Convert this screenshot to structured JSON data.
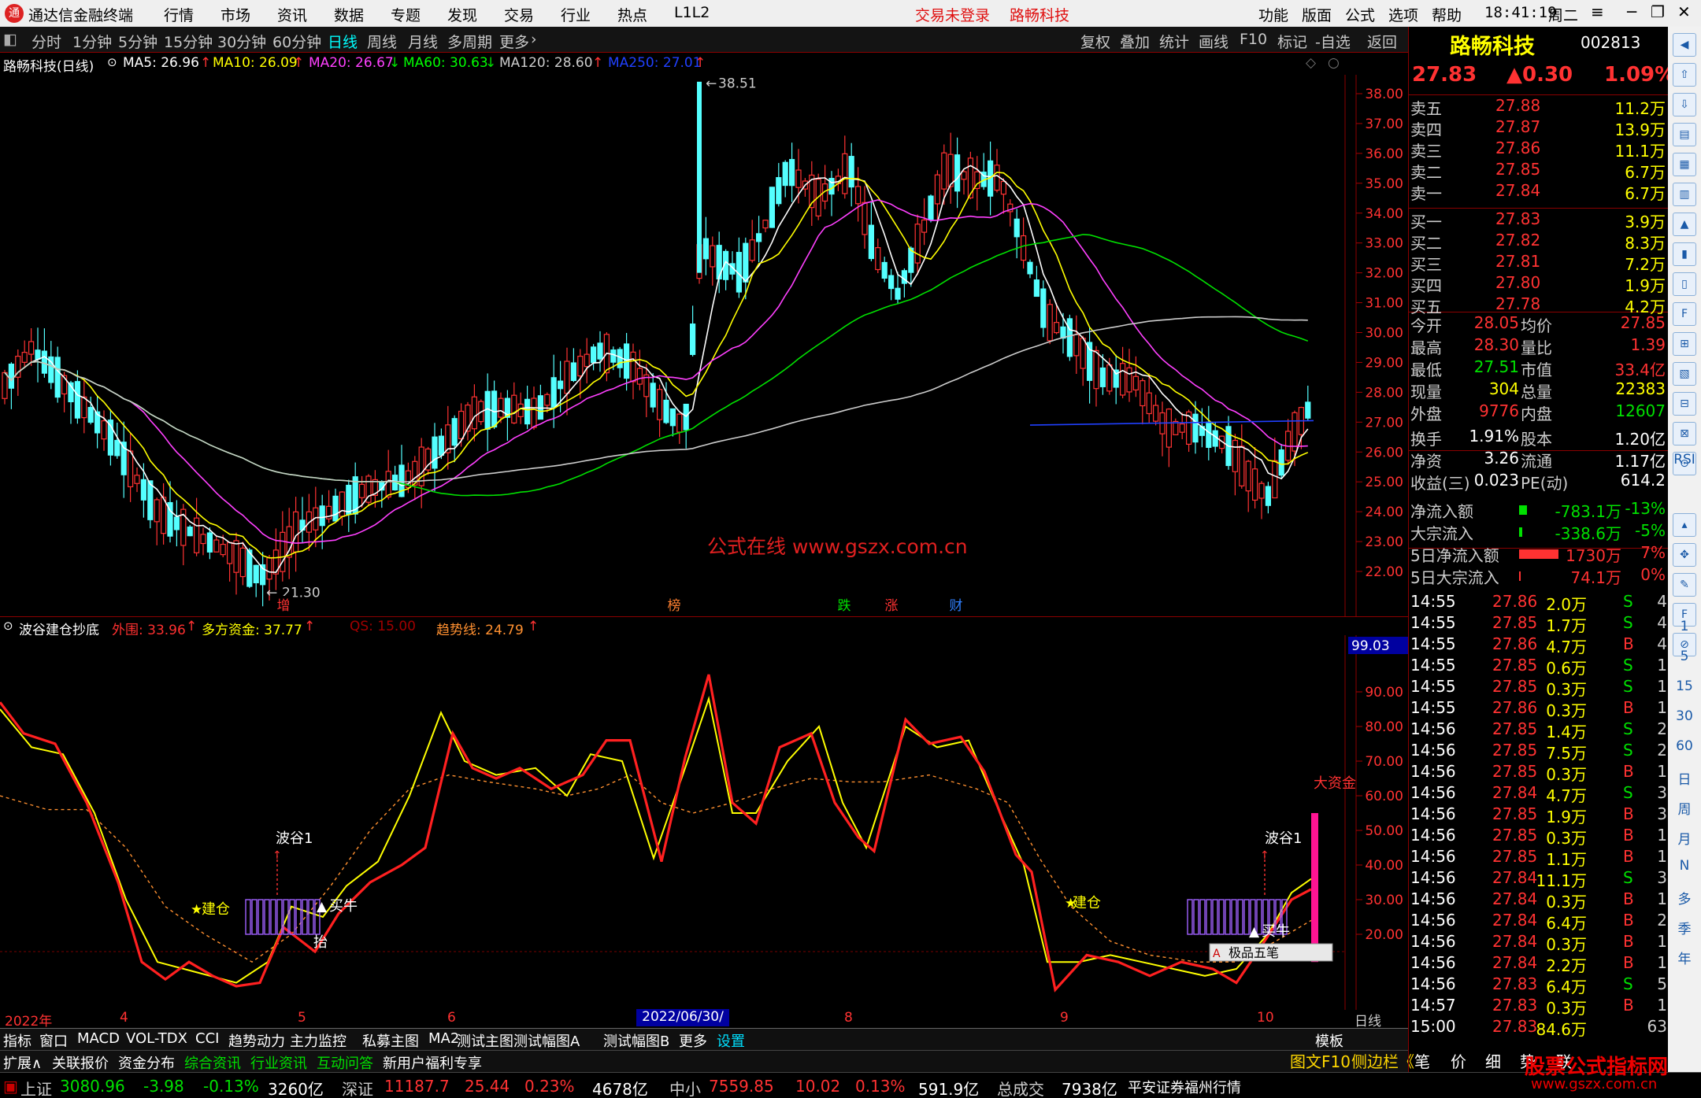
{
  "app": {
    "title": "通达信金融终端",
    "menus": [
      "行情",
      "市场",
      "资讯",
      "数据",
      "专题",
      "发现",
      "交易",
      "行业",
      "热点",
      "L1L2"
    ],
    "right_menus": [
      "功能",
      "版面",
      "公式",
      "选项",
      "帮助"
    ],
    "clock": "18:41:19",
    "weekday": "周二",
    "status_trade": "交易未登录",
    "status_stock": "路畅科技"
  },
  "toolbar": {
    "timeframes": [
      "分时",
      "1分钟",
      "5分钟",
      "15分钟",
      "30分钟",
      "60分钟",
      "日线",
      "周线",
      "月线",
      "多周期",
      "更多"
    ],
    "active_tf": "日线",
    "tools": [
      "复权",
      "叠加",
      "统计",
      "画线",
      "F10",
      "标记",
      "-自选",
      "返回"
    ]
  },
  "main": {
    "title": "路畅科技(日线)",
    "ma": [
      {
        "label": "MA5: 26.96",
        "color": "#ffffff"
      },
      {
        "label": "MA10: 26.09",
        "color": "#ffff00"
      },
      {
        "label": "MA20: 26.67",
        "color": "#ff40ff"
      },
      {
        "label": "MA60: 30.63",
        "color": "#00ff00"
      },
      {
        "label": "MA120: 28.60",
        "color": "#cccccc"
      },
      {
        "label": "MA250: 27.01",
        "color": "#2040ff"
      }
    ],
    "high_label": "38.51",
    "low_label": "21.30",
    "watermark": "公式在线  www.gszx.com.cn",
    "price_ticks": [
      "38.00",
      "37.00",
      "36.00",
      "35.00",
      "34.00",
      "33.00",
      "32.00",
      "31.00",
      "30.00",
      "29.00",
      "28.00",
      "27.00",
      "26.00",
      "25.00",
      "24.00",
      "23.00",
      "22.00"
    ],
    "event_tags": [
      "增",
      "榜",
      "跌",
      "涨",
      "财"
    ]
  },
  "indicator": {
    "name": "波谷建仓抄底",
    "fields": [
      {
        "label": "外围: 33.96",
        "color": "#ff3030"
      },
      {
        "label": "多方资金: 37.77",
        "color": "#ffff00"
      },
      {
        "label": "QS: 15.00",
        "color": "#a00000"
      },
      {
        "label": "趋势线: 24.79",
        "color": "#ff9030"
      }
    ],
    "cur_value": "99.03",
    "ticks": [
      "90.00",
      "80.00",
      "70.00",
      "60.00",
      "50.00",
      "40.00",
      "30.00",
      "20.00"
    ],
    "labels": {
      "wave1": "波谷1",
      "build": "建仓",
      "buy": "买牛",
      "bottom": "抬",
      "big_money": "大资金"
    },
    "popup": "极品五笔"
  },
  "xaxis": {
    "year": "2022年",
    "months": [
      "4",
      "5",
      "6",
      "8",
      "9",
      "10"
    ],
    "current_date": "2022/06/30/四",
    "period": "日线"
  },
  "index_tabs": [
    "指标",
    "窗口",
    "MACD",
    "VOL-TDX",
    "CCI",
    "趋势动力",
    "主力监控",
    "私募主图",
    "MA2",
    "测试主图",
    "测试幅图A",
    "测试幅图B",
    "更多",
    "设置",
    "模板"
  ],
  "news_tabs": [
    "扩展∧",
    "关联报价",
    "资金分布",
    "综合资讯",
    "行业资讯",
    "互动问答",
    "新用户福利专享"
  ],
  "bottom": {
    "items": [
      {
        "name": "上证",
        "val": "3080.96",
        "chg": "-3.98",
        "pct": "-0.13%",
        "amt": "3260亿"
      },
      {
        "name": "深证",
        "val": "11187.7",
        "chg": "25.44",
        "pct": "0.23%",
        "amt": "4678亿"
      },
      {
        "name": "中小",
        "val": "7559.85",
        "chg": "10.02",
        "pct": "0.13%",
        "amt": "591.9亿"
      }
    ],
    "total_label": "总成交",
    "total": "7938亿",
    "broker": "平安证券福州行情",
    "side_tabs": [
      "图文F10",
      "侧边栏《",
      "笔",
      "价",
      "细",
      "势",
      "联"
    ],
    "brand": "股票公式指标网",
    "brand_url": "www.gszx.com.cn"
  },
  "quote": {
    "name": "路畅科技",
    "code": "002813",
    "price": "27.83",
    "change": "▲0.30",
    "pct": "1.09%",
    "asks": [
      [
        "卖五",
        "27.88",
        "11.2万"
      ],
      [
        "卖四",
        "27.87",
        "13.9万"
      ],
      [
        "卖三",
        "27.86",
        "11.1万"
      ],
      [
        "卖二",
        "27.85",
        "6.7万"
      ],
      [
        "卖一",
        "27.84",
        "6.7万"
      ]
    ],
    "bids": [
      [
        "买一",
        "27.83",
        "3.9万"
      ],
      [
        "买二",
        "27.82",
        "8.3万"
      ],
      [
        "买三",
        "27.81",
        "7.2万"
      ],
      [
        "买四",
        "27.80",
        "1.9万"
      ],
      [
        "买五",
        "27.78",
        "4.2万"
      ]
    ],
    "stats": [
      [
        "今开",
        "28.05",
        "均价",
        "27.85"
      ],
      [
        "最高",
        "28.30",
        "量比",
        "1.39"
      ],
      [
        "最低",
        "27.51",
        "市值",
        "33.4亿"
      ],
      [
        "现量",
        "304",
        "总量",
        "22383"
      ],
      [
        "外盘",
        "9776",
        "内盘",
        "12607"
      ]
    ],
    "stats2": [
      [
        "换手",
        "1.91%",
        "股本",
        "1.20亿"
      ],
      [
        "净资",
        "3.26",
        "流通",
        "1.17亿"
      ],
      [
        "收益(三)",
        "0.023",
        "PE(动)",
        "614.2"
      ]
    ],
    "flows": [
      [
        "净流入额",
        "-783.1万",
        "-13%"
      ],
      [
        "大宗流入",
        "-338.6万",
        "-5%"
      ],
      [
        "5日净流入额",
        "1730万",
        "7%"
      ],
      [
        "5日大宗流入",
        "74.1万",
        "0%"
      ]
    ],
    "ticks": [
      [
        "14:55",
        "27.86",
        "2.0万",
        "S",
        "4"
      ],
      [
        "14:55",
        "27.85",
        "1.7万",
        "S",
        "4"
      ],
      [
        "14:55",
        "27.86",
        "4.7万",
        "B",
        "4"
      ],
      [
        "14:55",
        "27.85",
        "0.6万",
        "S",
        "1"
      ],
      [
        "14:55",
        "27.85",
        "0.3万",
        "S",
        "1"
      ],
      [
        "14:55",
        "27.86",
        "0.3万",
        "B",
        "1"
      ],
      [
        "14:56",
        "27.85",
        "1.4万",
        "S",
        "2"
      ],
      [
        "14:56",
        "27.85",
        "7.5万",
        "S",
        "2"
      ],
      [
        "14:56",
        "27.85",
        "0.3万",
        "B",
        "1"
      ],
      [
        "14:56",
        "27.84",
        "4.7万",
        "S",
        "3"
      ],
      [
        "14:56",
        "27.85",
        "1.9万",
        "B",
        "3"
      ],
      [
        "14:56",
        "27.85",
        "0.3万",
        "B",
        "1"
      ],
      [
        "14:56",
        "27.85",
        "1.1万",
        "B",
        "1"
      ],
      [
        "14:56",
        "27.84",
        "11.1万",
        "S",
        "3"
      ],
      [
        "14:56",
        "27.84",
        "0.3万",
        "B",
        "1"
      ],
      [
        "14:56",
        "27.84",
        "6.4万",
        "B",
        "2"
      ],
      [
        "14:56",
        "27.84",
        "0.3万",
        "B",
        "1"
      ],
      [
        "14:56",
        "27.84",
        "2.2万",
        "B",
        "1"
      ],
      [
        "14:56",
        "27.83",
        "6.4万",
        "S",
        "5"
      ],
      [
        "14:57",
        "27.83",
        "0.3万",
        "B",
        "1"
      ],
      [
        "15:00",
        "27.83",
        "84.6万",
        "",
        "63"
      ]
    ]
  },
  "icon_col": {
    "labels": [
      "RSI",
      "1",
      "5",
      "15",
      "30",
      "60",
      "日",
      "周",
      "月",
      "N",
      "多",
      "季",
      "年"
    ]
  }
}
